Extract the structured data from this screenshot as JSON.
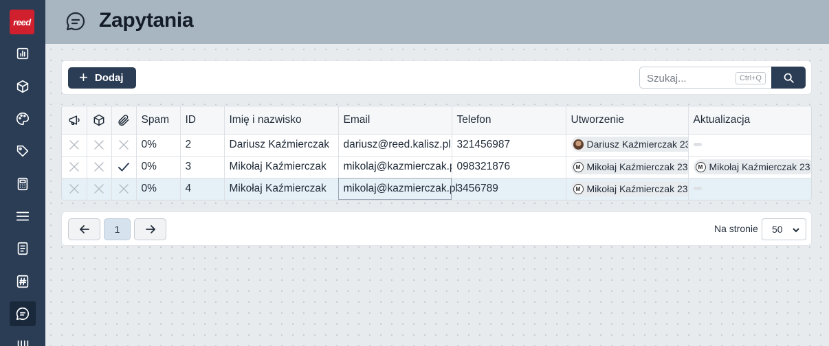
{
  "app": {
    "logo_text": "reed"
  },
  "header": {
    "title": "Zapytania"
  },
  "toolbar": {
    "add_label": "Dodaj",
    "search_placeholder": "Szukaj...",
    "search_shortcut": "Ctrl+Q"
  },
  "sidebar": {
    "items": [
      {
        "icon": "chart-icon"
      },
      {
        "icon": "box-icon"
      },
      {
        "icon": "palette-icon"
      },
      {
        "icon": "tag-icon"
      },
      {
        "icon": "calculator-icon"
      },
      {
        "icon": "menu-icon"
      },
      {
        "icon": "document-icon"
      },
      {
        "icon": "hash-icon"
      },
      {
        "icon": "chat-icon",
        "active": true
      },
      {
        "icon": "columns-icon"
      }
    ]
  },
  "table": {
    "columns": [
      "Spam",
      "ID",
      "Imię i nazwisko",
      "Email",
      "Telefon",
      "Utworzenie",
      "Aktualizacja"
    ],
    "icon_columns": [
      "megaphone-icon",
      "box-icon",
      "paperclip-icon"
    ],
    "rows": [
      {
        "flags": [
          "x",
          "x",
          "x"
        ],
        "spam": "0%",
        "id": "2",
        "name": "Dariusz Kaźmierczak",
        "email": "dariusz@reed.kalisz.pl",
        "phone": "321456987",
        "created": "Dariusz Kaźmierczak  23",
        "updated": ""
      },
      {
        "flags": [
          "x",
          "x",
          "check"
        ],
        "spam": "0%",
        "id": "3",
        "name": "Mikołaj Kaźmierczak",
        "email": "mikolaj@kazmierczak.pl",
        "phone": "098321876",
        "created": "Mikołaj Kaźmierczak  23",
        "updated": "Mikołaj Kaźmierczak  23"
      },
      {
        "flags": [
          "x",
          "x",
          "x"
        ],
        "spam": "0%",
        "id": "4",
        "name": "Mikołaj Kaźmierczak",
        "email": "mikolaj@kazmierczak.pl",
        "phone": "3456789",
        "created": "Mikołaj Kaźmierczak  23",
        "updated": ""
      }
    ]
  },
  "pagination": {
    "current_page": "1",
    "per_page_label": "Na stronie",
    "per_page_value": "50"
  },
  "colors": {
    "sidebar": "#2b3d55",
    "header": "#a8b6c1",
    "accent": "#2b3d55",
    "logo": "#d0202e"
  }
}
